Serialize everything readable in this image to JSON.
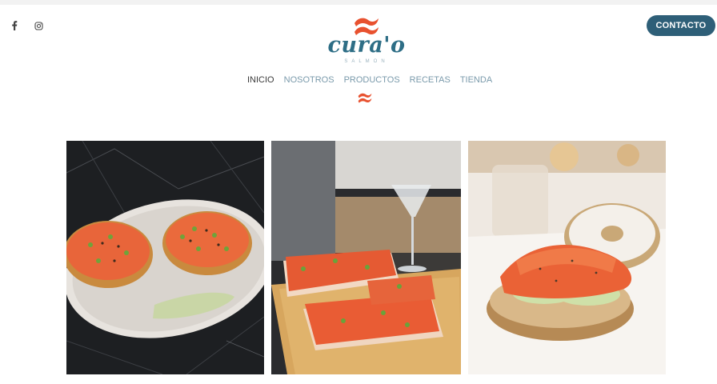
{
  "header": {
    "social": [
      {
        "icon": "facebook-icon"
      },
      {
        "icon": "instagram-icon"
      }
    ],
    "logo": {
      "brand": "cura'o",
      "sub": "SALMON"
    },
    "contact_label": "CONTACTO"
  },
  "nav": {
    "items": [
      {
        "label": "INICIO",
        "active": true
      },
      {
        "label": "NOSOTROS"
      },
      {
        "label": "PRODUCTOS"
      },
      {
        "label": "RECETAS"
      },
      {
        "label": "TIENDA"
      }
    ]
  },
  "gallery": {
    "photos": [
      {
        "subject": "two salmon bagels on white plate on black marble"
      },
      {
        "subject": "salmon toasts on wooden board with martini glass"
      },
      {
        "subject": "salmon bagel with cucumber slices"
      }
    ]
  },
  "colors": {
    "accent": "#e8512f",
    "brand": "#2e6e86",
    "button": "#2e5f78",
    "nav": "#7a9aab"
  }
}
